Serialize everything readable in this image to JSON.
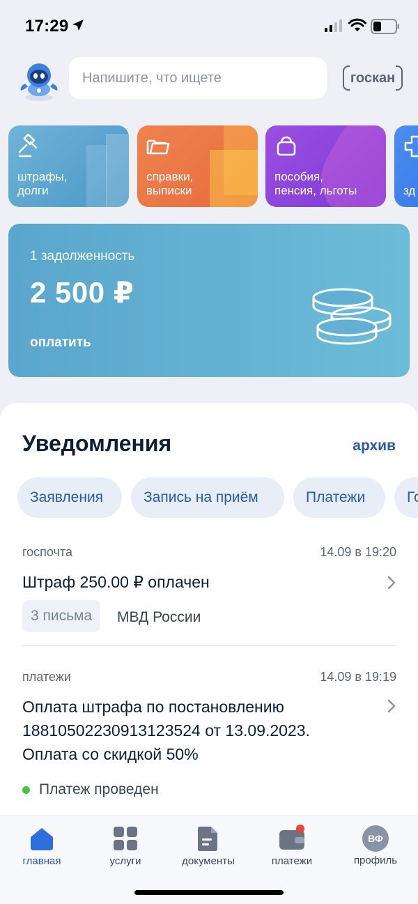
{
  "status_bar": {
    "time": "17:29"
  },
  "search": {
    "placeholder": "Напишите, что ищете",
    "scan_label": "госкан"
  },
  "categories": [
    {
      "label": "штрафы,\nдолги",
      "color": "#5aa6d4"
    },
    {
      "label": "справки,\nвыписки",
      "color": "#ec7a47"
    },
    {
      "label": "пособия,\nпенсия, льготы",
      "color": "#8e46dc"
    },
    {
      "label": "зд",
      "color": "#3f84ea"
    }
  ],
  "debt": {
    "label": "1 задолженность",
    "amount": "2 500 ₽",
    "pay_label": "оплатить"
  },
  "notifications": {
    "title": "Уведомления",
    "archive_label": "архив",
    "filters": [
      "Заявления",
      "Запись на приём",
      "Платежи",
      "Го"
    ],
    "items": [
      {
        "category": "госпочта",
        "datetime": "14.09 в 19:20",
        "title": "Штраф 250.00 ₽ оплачен",
        "letters": "3 письма",
        "sender": "МВД России"
      },
      {
        "category": "платежи",
        "datetime": "14.09 в 19:19",
        "title_lines": [
          "Оплата штрафа по постановлению",
          "18810502230913123524 от 13.09.2023.",
          "Оплата со скидкой 50%"
        ],
        "status": "Платеж проведен"
      }
    ]
  },
  "tabbar": {
    "tabs": [
      {
        "label": "главная",
        "icon": "home-icon",
        "active": true
      },
      {
        "label": "услуги",
        "icon": "grid-icon"
      },
      {
        "label": "документы",
        "icon": "document-icon"
      },
      {
        "label": "платежи",
        "icon": "wallet-icon",
        "badge": true
      },
      {
        "label": "профиль",
        "icon": "avatar",
        "initials": "ВФ"
      }
    ]
  },
  "colors": {
    "accent": "#2a59a8",
    "success": "#45c54a",
    "badge": "#e8463e"
  }
}
